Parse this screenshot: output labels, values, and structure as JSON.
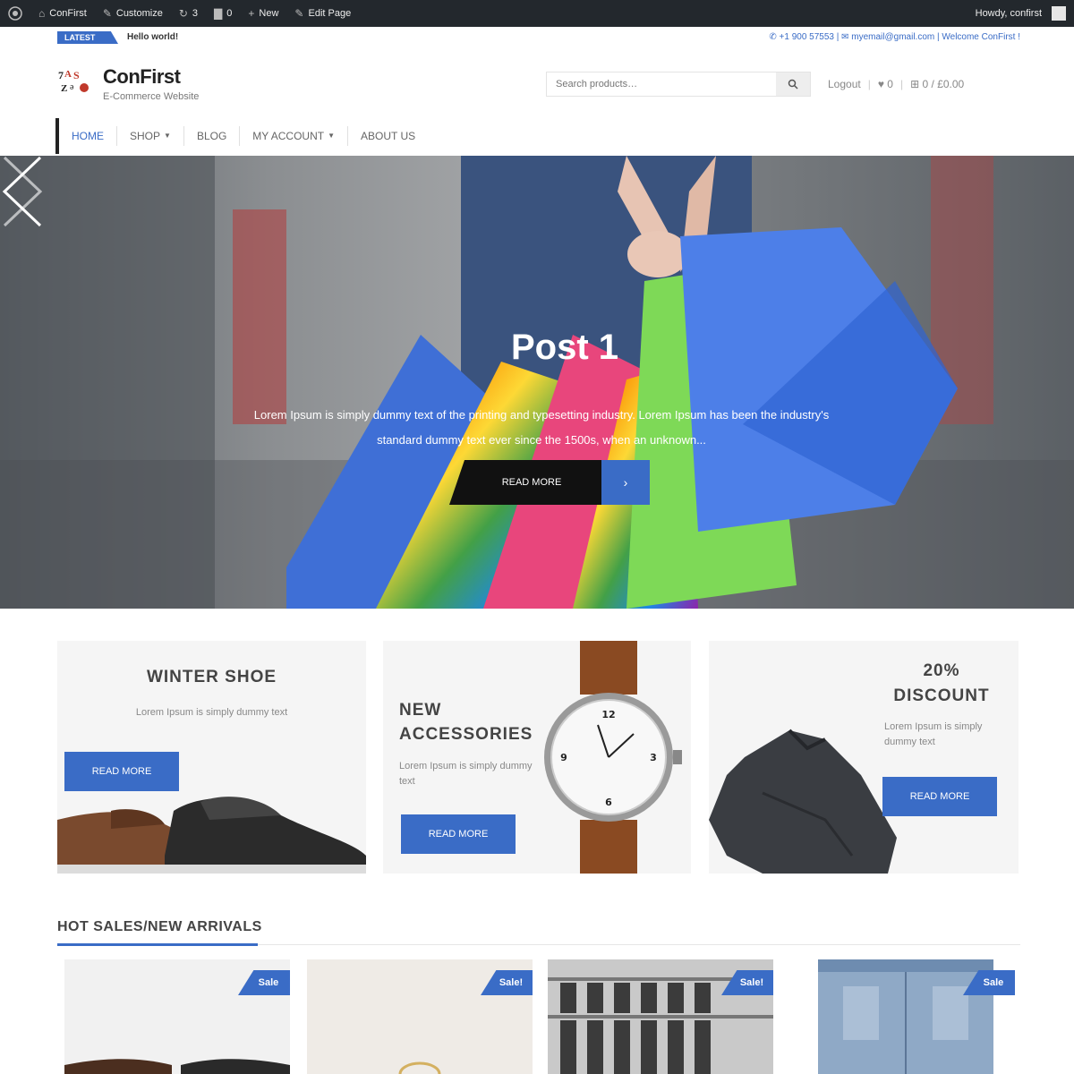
{
  "adminbar": {
    "site_name": "ConFirst",
    "customize": "Customize",
    "updates_count": "3",
    "comments_count": "0",
    "new_label": "New",
    "edit_page": "Edit Page",
    "howdy": "Howdy, confirst"
  },
  "topbar": {
    "latest_label": "LATEST",
    "ticker_text": "Hello world!",
    "contact_text": "✆ +1 900 57553 | ✉ myemail@gmail.com | Welcome ConFirst !"
  },
  "header": {
    "site_title": "ConFirst",
    "tagline": "E-Commerce Website",
    "search_placeholder": "Search products…",
    "logout": "Logout",
    "cart_count": "0",
    "cart_total": "0 / £0.00"
  },
  "nav": {
    "items": [
      {
        "label": "HOME",
        "has_dropdown": false,
        "active": true
      },
      {
        "label": "SHOP",
        "has_dropdown": true,
        "active": false
      },
      {
        "label": "BLOG",
        "has_dropdown": false,
        "active": false
      },
      {
        "label": "MY ACCOUNT",
        "has_dropdown": true,
        "active": false
      },
      {
        "label": "ABOUT US",
        "has_dropdown": false,
        "active": false
      }
    ]
  },
  "slider": {
    "title": "Post 1",
    "text": "Lorem Ipsum is simply dummy text of the printing and typesetting industry. Lorem Ipsum has been the industry's standard dummy text ever since the 1500s, when an unknown...",
    "button_label": "READ MORE"
  },
  "promos": [
    {
      "title": "WINTER SHOE",
      "text": "Lorem Ipsum is simply dummy text",
      "button_label": "READ MORE"
    },
    {
      "title": "NEW ACCESSORIES",
      "text": "Lorem Ipsum is simply dummy text",
      "button_label": "READ MORE"
    },
    {
      "title": "20% DISCOUNT",
      "text": "Lorem Ipsum is simply dummy text",
      "button_label": "READ MORE"
    }
  ],
  "section": {
    "heading": "HOT SALES/NEW ARRIVALS"
  },
  "products": [
    {
      "badge": "Sale"
    },
    {
      "badge": "Sale!"
    },
    {
      "badge": "Sale!"
    },
    {
      "badge": "Sale"
    }
  ],
  "colors": {
    "accent": "#3a6cc6",
    "adminbar": "#23282d"
  }
}
